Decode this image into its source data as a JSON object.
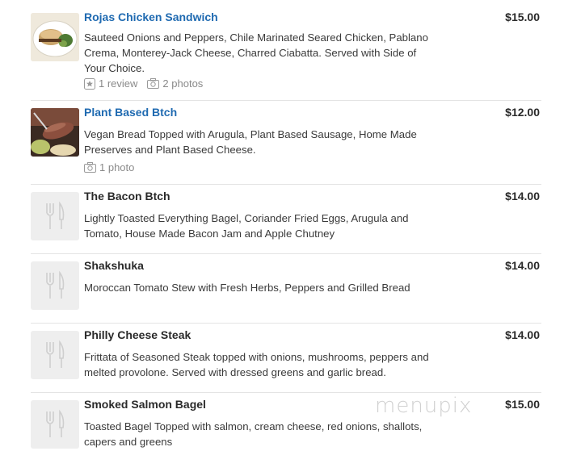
{
  "items": [
    {
      "name": "Rojas Chicken Sandwich",
      "price": "$15.00",
      "description": "Sauteed Onions and Peppers, Chile Marinated Seared Chicken, Pablano Crema, Monterey-Jack Cheese, Charred Ciabatta. Served with Side of Your Choice.",
      "reviews": "1 review",
      "photos": "2 photos",
      "icon": "sandwich-photo"
    },
    {
      "name": "Plant Based Btch",
      "price": "$12.00",
      "description": "Vegan Bread Topped with Arugula, Plant Based Sausage, Home Made Preserves and Plant Based Cheese.",
      "photos": "1 photo",
      "icon": "sausage-photo"
    },
    {
      "name": "The Bacon Btch",
      "price": "$14.00",
      "description": "Lightly Toasted Everything Bagel, Coriander Fried Eggs, Arugula and Tomato, House Made Bacon Jam and Apple Chutney",
      "icon": "utensils-icon"
    },
    {
      "name": "Shakshuka",
      "price": "$14.00",
      "description": "Moroccan Tomato Stew with Fresh Herbs, Peppers and Grilled Bread",
      "icon": "utensils-icon"
    },
    {
      "name": "Philly Cheese Steak",
      "price": "$14.00",
      "description": "Frittata of Seasoned Steak topped with onions, mushrooms, peppers and melted provolone. Served with dressed greens and garlic bread.",
      "icon": "utensils-icon"
    },
    {
      "name": "Smoked Salmon Bagel",
      "price": "$15.00",
      "description": "Toasted Bagel Topped with salmon, cream cheese, red onions, shallots, capers and greens",
      "icon": "utensils-icon"
    }
  ],
  "watermark": "menupix",
  "colors": {
    "link": "#1f6ab1",
    "text": "#333333",
    "muted": "#8a8a8a",
    "divider": "#e4e4e4"
  }
}
